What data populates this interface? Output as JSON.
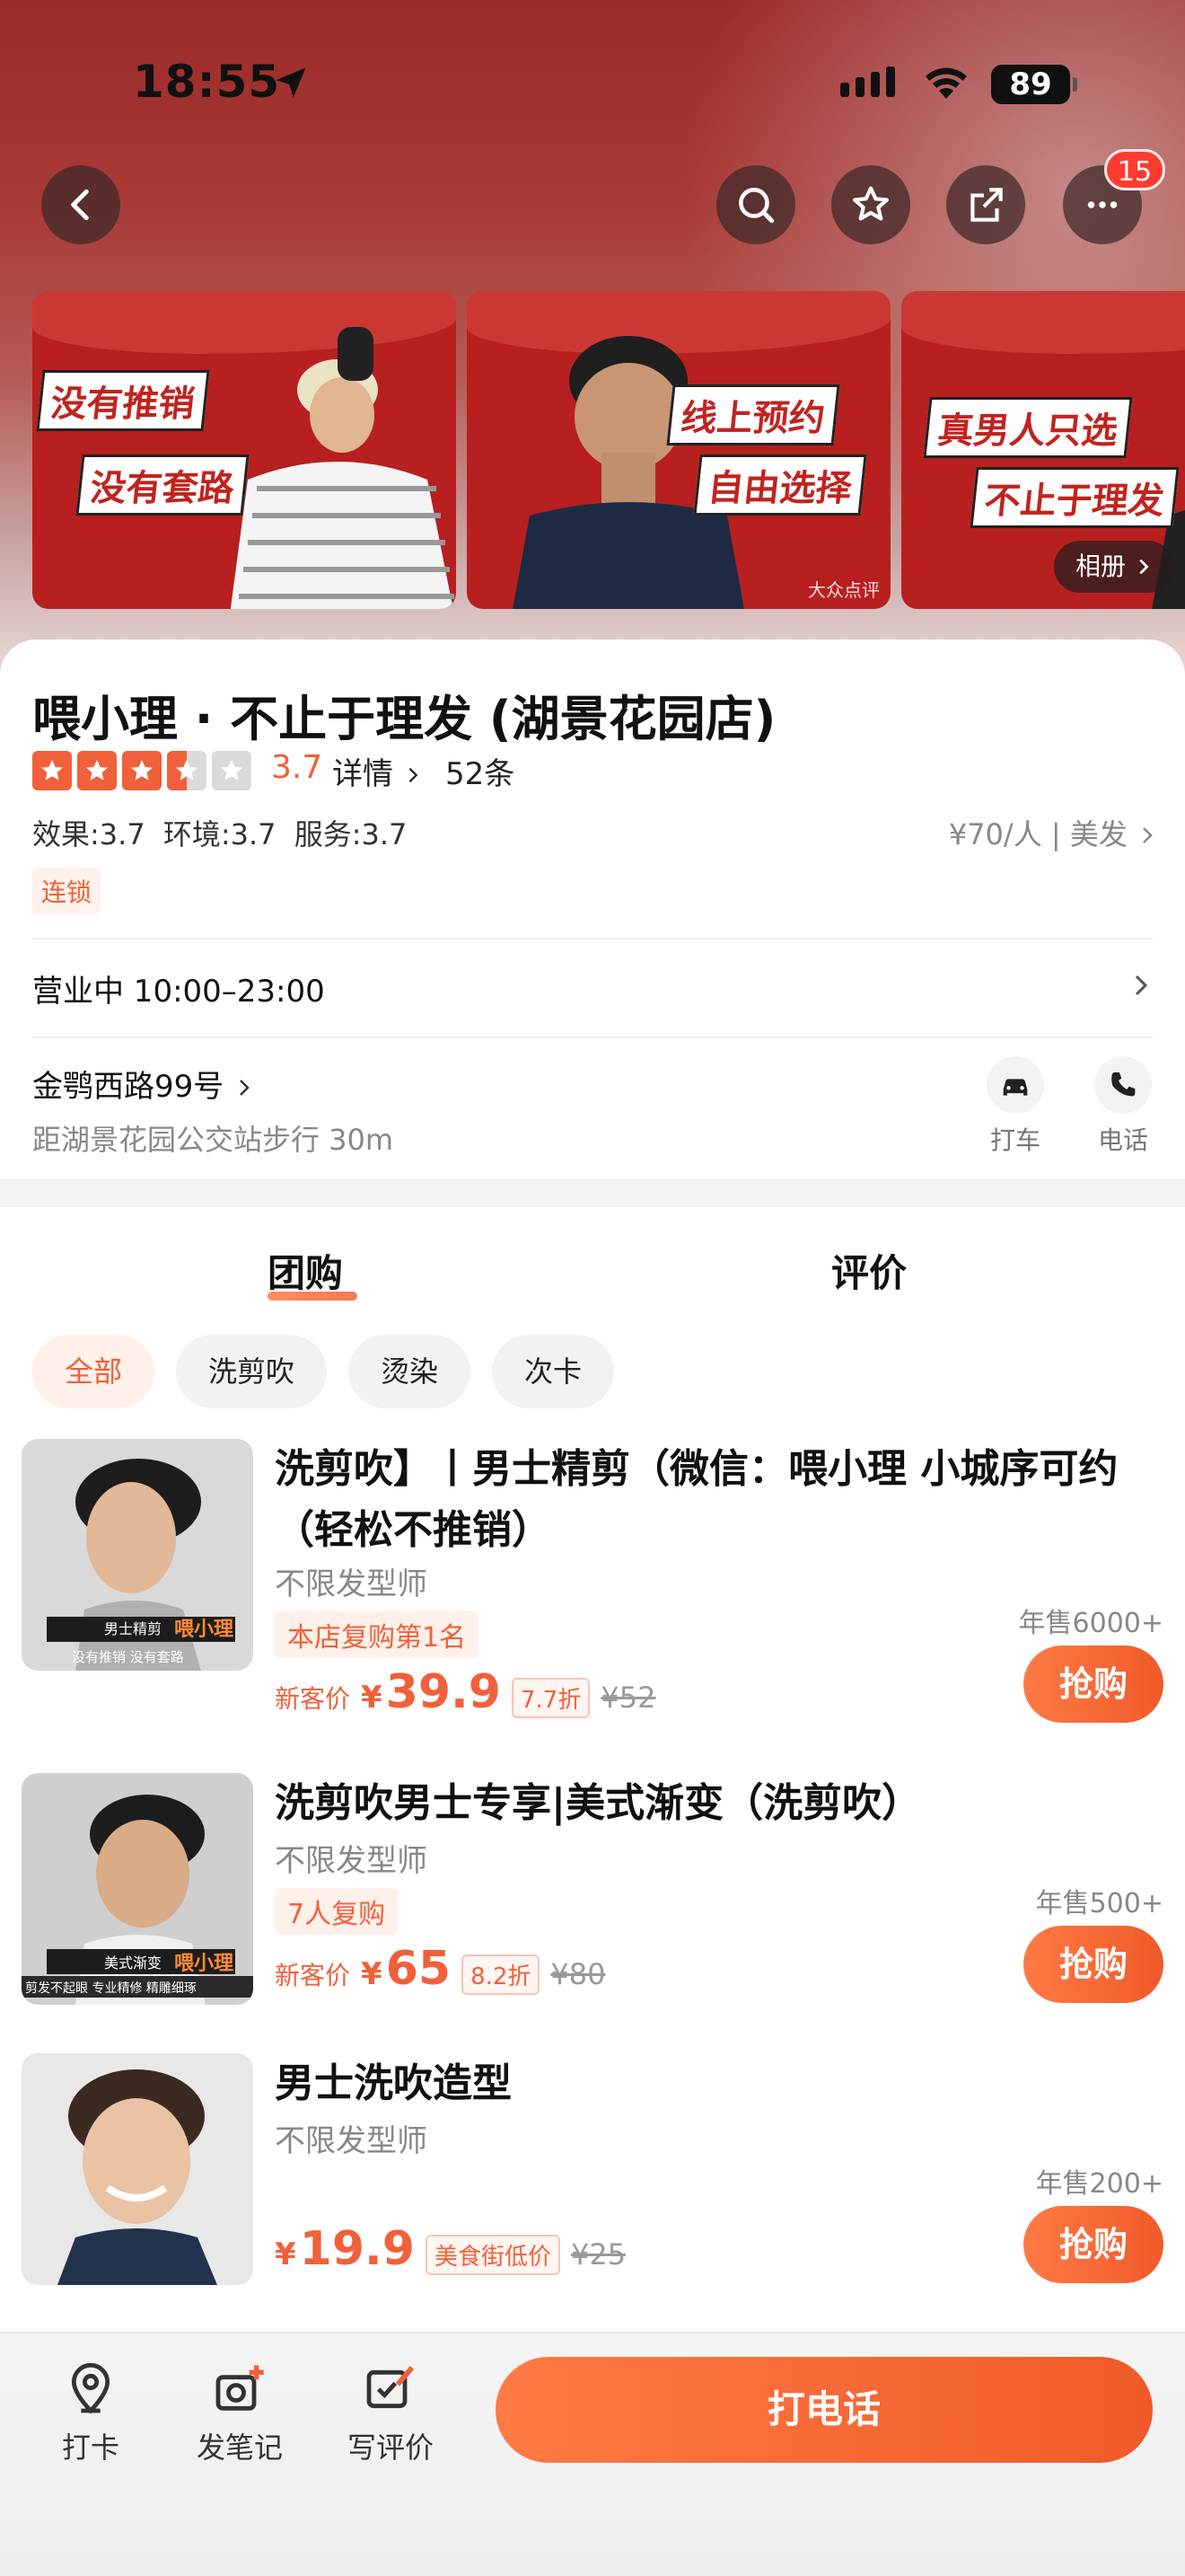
{
  "status_bar": {
    "time": "18:55",
    "battery": "89"
  },
  "nav": {
    "notification_count": "15"
  },
  "album": {
    "slogans": [
      [
        "没有推销",
        "没有套路"
      ],
      [
        "线上预约",
        "自由选择"
      ],
      [
        "真男人只选",
        "不止于理发"
      ]
    ],
    "watermark": "大众点评",
    "album_button": "相册"
  },
  "shop": {
    "name": "喂小理 · 不止于理发 (湖景花园店)",
    "rating": "3.7",
    "rating_value": 3.7,
    "detail_link": "详情",
    "review_count": "52条",
    "sub_scores": "效果:3.7  环境:3.7  服务:3.7",
    "price_category": "¥70/人 | 美发",
    "chain_tag": "连锁",
    "hours": "营业中 10:00–23:00",
    "address": "金鹗西路99号",
    "distance": "距湖景花园公交站步行 30m",
    "actions": {
      "taxi": "打车",
      "phone": "电话"
    }
  },
  "tabs": [
    {
      "label": "团购"
    },
    {
      "label": "评价"
    }
  ],
  "chips": [
    "全部",
    "洗剪吹",
    "烫染",
    "次卡"
  ],
  "deals": [
    {
      "title": "洗剪吹】丨男士精剪（微信：喂小理 小城序可约（轻松不推销）",
      "stylist": "不限发型师",
      "tag": "本店复购第1名",
      "new_customer": "新客价",
      "yen": "¥",
      "price": "39.9",
      "discount": "7.7折",
      "original": "¥52",
      "sold": "年售6000+",
      "buy": "抢购",
      "thumb_caption": "男士精剪",
      "thumb_brand": "喂小理",
      "thumb_tagline": "没有推销 没有套路"
    },
    {
      "title": "洗剪吹男士专享|美式渐变（洗剪吹）",
      "stylist": "不限发型师",
      "tag": "7人复购",
      "new_customer": "新客价",
      "yen": "¥",
      "price": "65",
      "discount": "8.2折",
      "original": "¥80",
      "sold": "年售500+",
      "buy": "抢购",
      "thumb_caption": "美式渐变",
      "thumb_brand": "喂小理",
      "thumb_tagline": "剪发不起眼 专业精修 精雕细琢"
    },
    {
      "title": "男士洗吹造型",
      "stylist": "不限发型师",
      "yen": "¥",
      "price": "19.9",
      "discount": "美食街低价",
      "original": "¥25",
      "sold": "年售200+",
      "buy": "抢购"
    }
  ],
  "bottom_bar": {
    "checkin": "打卡",
    "post_note": "发笔记",
    "write_review": "写评价",
    "call": "打电话"
  }
}
